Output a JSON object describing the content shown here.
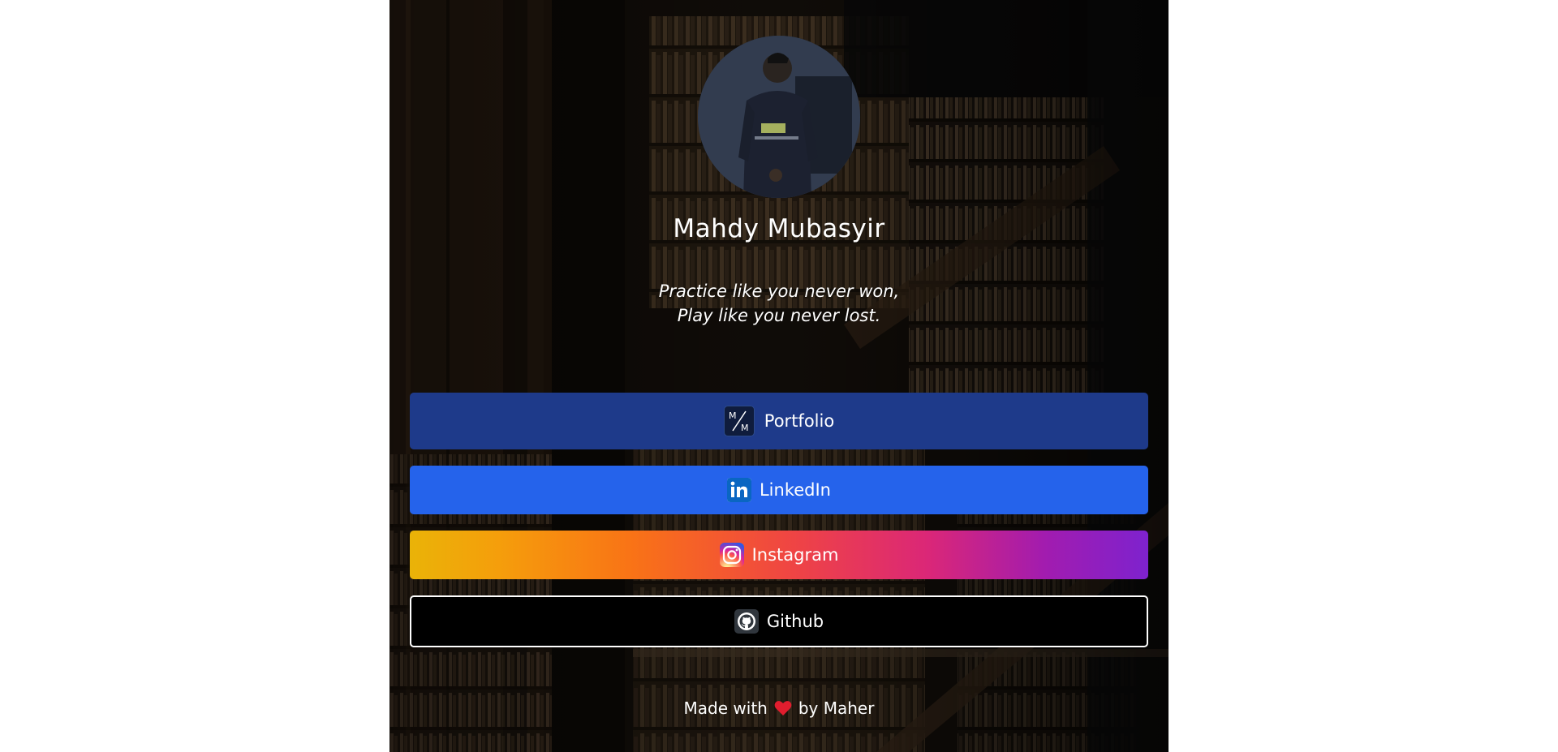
{
  "profile": {
    "name": "Mahdy Mubasyir",
    "quote_line1": "Practice like you never won,",
    "quote_line2": "Play like you never lost."
  },
  "links": {
    "portfolio": {
      "label": "Portfolio",
      "icon": "mm-logo-icon",
      "color": "#1e3a8a"
    },
    "linkedin": {
      "label": "LinkedIn",
      "icon": "linkedin-icon",
      "color": "#2563eb"
    },
    "instagram": {
      "label": "Instagram",
      "icon": "instagram-icon"
    },
    "github": {
      "label": "Github",
      "icon": "github-icon",
      "color": "#000000"
    }
  },
  "footer": {
    "prefix": "Made with",
    "suffix": "by Maher",
    "icon": "heart-icon"
  }
}
